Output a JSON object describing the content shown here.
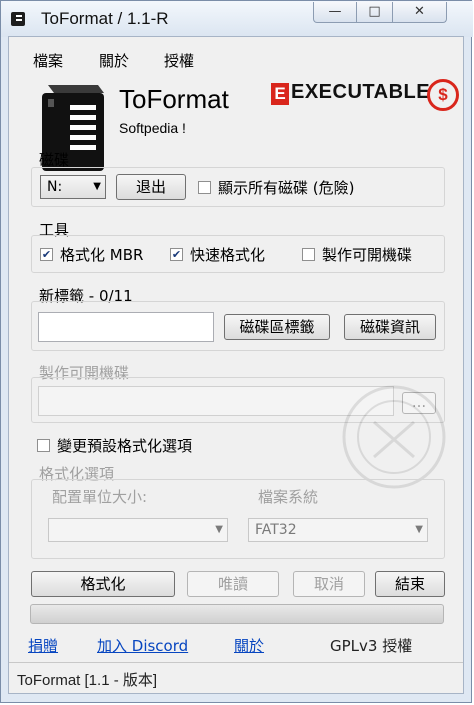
{
  "window": {
    "title": "ToFormat  / 1.1-R",
    "minimize": "—",
    "maximize": "□",
    "close": "✕"
  },
  "menu": [
    "檔案",
    "關於",
    "授權"
  ],
  "header": {
    "app_name": "ToFormat",
    "subtitle": "Softpedia !",
    "badge_text": "EXECUTABLE",
    "badge_letter": "E",
    "badge_symbol": "$"
  },
  "disk": {
    "label": "磁碟",
    "drive_value": "N:",
    "eject_button": "退出",
    "show_all_label": "顯示所有磁碟 (危險)",
    "show_all_checked": false
  },
  "tools": {
    "label": "工具",
    "mbr_label": "格式化 MBR",
    "mbr_checked": true,
    "quick_label": "快速格式化",
    "quick_checked": true,
    "bootable_label": "製作可開機碟",
    "bootable_checked": false
  },
  "new_label": {
    "label": "新標籤 - 0/11",
    "value": "",
    "disk_label_button": "磁碟區標籤",
    "disk_info_button": "磁碟資訊"
  },
  "bootable": {
    "label": "製作可開機碟",
    "path_value": "",
    "browse_button": "..."
  },
  "change_defaults": {
    "label": "變更預設格式化選項",
    "checked": false
  },
  "format_options": {
    "label": "格式化選項",
    "alloc_label": "配置單位大小:",
    "alloc_value": "",
    "fs_label": "檔案系統",
    "fs_value": "FAT32"
  },
  "actions": {
    "format": "格式化",
    "readonly": "唯讀",
    "cancel": "取消",
    "exit": "結束"
  },
  "progress": 0,
  "footer_links": {
    "donate": "捐贈",
    "discord": "加入 Discord",
    "about": "關於",
    "license": "GPLv3 授權"
  },
  "status": "ToFormat [1.1 - 版本]",
  "colors": {
    "link": "#0645c0",
    "badge_red": "#d9261c",
    "window_frame": "#dfe8f3"
  }
}
